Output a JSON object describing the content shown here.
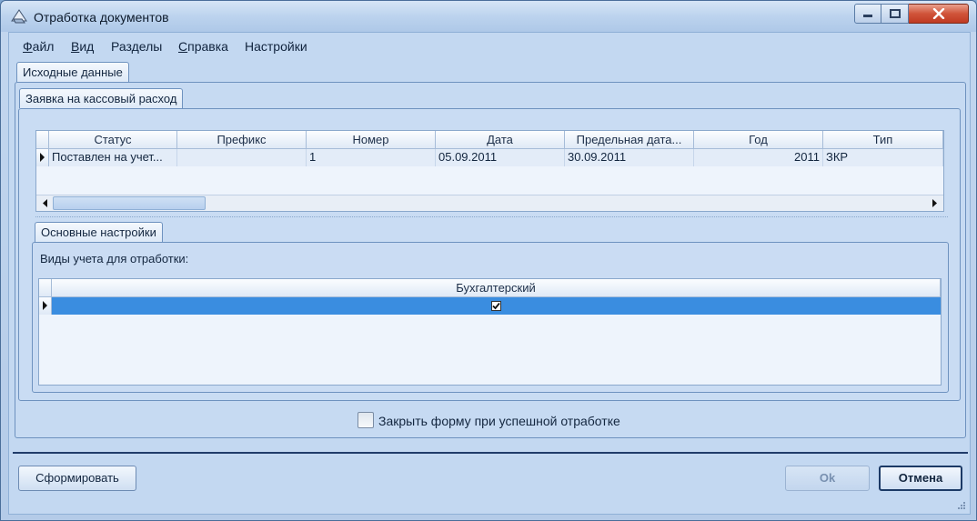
{
  "window": {
    "title": "Отработка документов"
  },
  "menu": [
    "Файл",
    "Вид",
    "Разделы",
    "Справка",
    "Настройки"
  ],
  "tabs": {
    "outer": "Исходные данные",
    "inner": "Заявка на кассовый расход",
    "settings": "Основные настройки"
  },
  "doc_grid": {
    "columns": [
      "Статус",
      "Префикс",
      "Номер",
      "Дата",
      "Предельная дата...",
      "Год",
      "Тип"
    ],
    "rows": [
      [
        "Поставлен на учет...",
        "",
        "1",
        "05.09.2011",
        "30.09.2011",
        "2011",
        "ЗКР"
      ]
    ]
  },
  "settings": {
    "label": "Виды учета для отработки:",
    "columns": [
      "Бухгалтерский"
    ],
    "rows": [
      {
        "checked": true
      }
    ]
  },
  "close_on_success": {
    "label": "Закрыть форму при успешной отработке",
    "checked": false
  },
  "buttons": {
    "generate": "Сформировать",
    "ok": "Ok",
    "cancel": "Отмена"
  },
  "colors": {
    "selection": "#3a8de0",
    "accent": "#1c3a66"
  }
}
